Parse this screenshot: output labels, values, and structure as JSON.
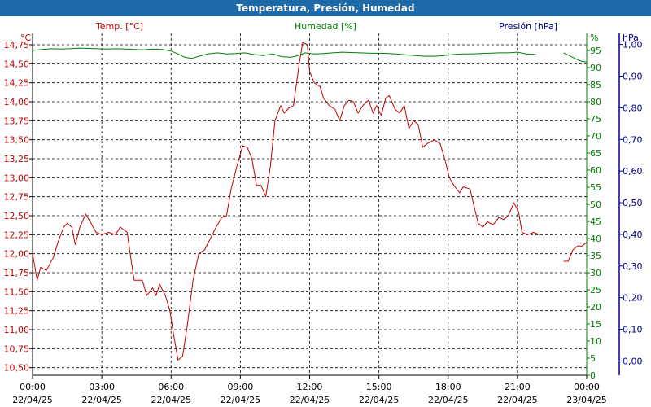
{
  "window": {
    "title": "Temperatura, Presión, Humedad"
  },
  "colors": {
    "temperature": "#c00000",
    "humidity": "#008000",
    "pressure": "#00008b",
    "titlebar": "#1e6aa8"
  },
  "chart_data": {
    "type": "line",
    "title": "Temperatura, Presión, Humedad",
    "legend": {
      "temperature": "Temp. [°C]",
      "humidity": "Humedad [%]",
      "pressure": "Presión [hPa]"
    },
    "axes": {
      "temperature": {
        "unit": "°C",
        "min": 10.4,
        "max": 14.9,
        "ticks": [
          "10,50",
          "10,75",
          "11,00",
          "11,25",
          "11,50",
          "11,75",
          "12,00",
          "12,25",
          "12,50",
          "12,75",
          "13,00",
          "13,25",
          "13,50",
          "13,75",
          "14,00",
          "14,25",
          "14,50",
          "14,75"
        ]
      },
      "humidity": {
        "unit": "%",
        "min": 0,
        "max": 100,
        "ticks": [
          "0",
          "5",
          "10",
          "15",
          "20",
          "25",
          "30",
          "35",
          "40",
          "45",
          "50",
          "55",
          "60",
          "65",
          "70",
          "75",
          "80",
          "85",
          "90",
          "95"
        ]
      },
      "pressure": {
        "unit": "hPa",
        "min": -0.045,
        "max": 1.035,
        "ticks": [
          "0,00",
          "0,10",
          "0,20",
          "0,30",
          "0,40",
          "0,50",
          "0,60",
          "0,70",
          "0,80",
          "0,90",
          "1,00"
        ]
      },
      "x": {
        "ticks": [
          {
            "time": "00:00",
            "date": "22/04/25"
          },
          {
            "time": "03:00",
            "date": "22/04/25"
          },
          {
            "time": "06:00",
            "date": "22/04/25"
          },
          {
            "time": "09:00",
            "date": "22/04/25"
          },
          {
            "time": "12:00",
            "date": "22/04/25"
          },
          {
            "time": "15:00",
            "date": "22/04/25"
          },
          {
            "time": "18:00",
            "date": "22/04/25"
          },
          {
            "time": "21:00",
            "date": "22/04/25"
          },
          {
            "time": "00:00",
            "date": "23/04/25"
          }
        ]
      }
    },
    "grid": true,
    "series": [
      {
        "name": "Temp. [°C]",
        "axis": "temperature",
        "segments": [
          [
            [
              0.0,
              12.0
            ],
            [
              0.2,
              11.65
            ],
            [
              0.35,
              11.82
            ],
            [
              0.6,
              11.78
            ],
            [
              0.9,
              11.95
            ],
            [
              1.1,
              12.15
            ],
            [
              1.35,
              12.35
            ],
            [
              1.5,
              12.4
            ],
            [
              1.7,
              12.35
            ],
            [
              1.85,
              12.12
            ],
            [
              2.05,
              12.35
            ],
            [
              2.3,
              12.52
            ],
            [
              2.5,
              12.42
            ],
            [
              2.75,
              12.28
            ],
            [
              3.0,
              12.25
            ],
            [
              3.3,
              12.28
            ],
            [
              3.6,
              12.25
            ],
            [
              3.8,
              12.35
            ],
            [
              4.1,
              12.28
            ],
            [
              4.25,
              11.95
            ],
            [
              4.4,
              11.65
            ],
            [
              4.75,
              11.65
            ],
            [
              4.95,
              11.45
            ],
            [
              5.2,
              11.55
            ],
            [
              5.35,
              11.45
            ],
            [
              5.5,
              11.6
            ],
            [
              5.75,
              11.45
            ],
            [
              5.95,
              11.25
            ],
            [
              6.1,
              10.95
            ],
            [
              6.3,
              10.6
            ],
            [
              6.5,
              10.65
            ],
            [
              6.7,
              11.05
            ],
            [
              6.95,
              11.65
            ],
            [
              7.2,
              12.0
            ],
            [
              7.45,
              12.05
            ],
            [
              7.7,
              12.2
            ],
            [
              7.95,
              12.35
            ],
            [
              8.2,
              12.48
            ],
            [
              8.4,
              12.5
            ],
            [
              8.6,
              12.85
            ],
            [
              8.85,
              13.15
            ],
            [
              9.1,
              13.42
            ],
            [
              9.3,
              13.4
            ],
            [
              9.5,
              13.25
            ],
            [
              9.7,
              12.9
            ],
            [
              9.9,
              12.9
            ],
            [
              10.1,
              12.75
            ],
            [
              10.3,
              13.15
            ],
            [
              10.5,
              13.75
            ],
            [
              10.75,
              13.95
            ],
            [
              10.9,
              13.85
            ],
            [
              11.1,
              13.92
            ],
            [
              11.3,
              13.95
            ],
            [
              11.55,
              14.5
            ],
            [
              11.7,
              14.78
            ],
            [
              11.9,
              14.75
            ],
            [
              12.0,
              14.4
            ],
            [
              12.2,
              14.25
            ],
            [
              12.45,
              14.2
            ],
            [
              12.6,
              14.05
            ],
            [
              12.85,
              13.95
            ],
            [
              13.1,
              13.9
            ],
            [
              13.3,
              13.75
            ],
            [
              13.5,
              13.95
            ],
            [
              13.7,
              14.02
            ],
            [
              13.9,
              14.0
            ],
            [
              14.1,
              13.85
            ],
            [
              14.3,
              13.95
            ],
            [
              14.55,
              14.02
            ],
            [
              14.75,
              13.85
            ],
            [
              14.9,
              13.95
            ],
            [
              15.1,
              13.82
            ],
            [
              15.3,
              14.05
            ],
            [
              15.45,
              14.08
            ],
            [
              15.7,
              13.9
            ],
            [
              15.9,
              13.85
            ],
            [
              16.1,
              13.95
            ],
            [
              16.3,
              13.65
            ],
            [
              16.5,
              13.75
            ],
            [
              16.7,
              13.7
            ],
            [
              16.9,
              13.4
            ],
            [
              17.1,
              13.45
            ],
            [
              17.4,
              13.5
            ],
            [
              17.65,
              13.45
            ],
            [
              17.85,
              13.25
            ],
            [
              18.05,
              13.0
            ],
            [
              18.25,
              12.9
            ],
            [
              18.5,
              12.8
            ],
            [
              18.65,
              12.88
            ],
            [
              18.95,
              12.85
            ],
            [
              19.1,
              12.65
            ],
            [
              19.3,
              12.4
            ],
            [
              19.5,
              12.35
            ],
            [
              19.7,
              12.42
            ],
            [
              19.95,
              12.38
            ],
            [
              20.2,
              12.48
            ],
            [
              20.4,
              12.45
            ],
            [
              20.6,
              12.5
            ],
            [
              20.85,
              12.67
            ],
            [
              21.05,
              12.55
            ],
            [
              21.2,
              12.28
            ],
            [
              21.45,
              12.25
            ],
            [
              21.7,
              12.28
            ],
            [
              21.95,
              12.25
            ]
          ],
          [
            [
              23.0,
              11.9
            ],
            [
              23.2,
              11.9
            ],
            [
              23.4,
              12.05
            ],
            [
              23.6,
              12.1
            ],
            [
              23.8,
              12.1
            ],
            [
              24.0,
              12.15
            ]
          ]
        ]
      },
      {
        "name": "Humedad [%]",
        "axis": "humidity",
        "segments": [
          [
            [
              0.0,
              95.0
            ],
            [
              0.4,
              95.3
            ],
            [
              0.8,
              95.5
            ],
            [
              1.2,
              95.4
            ],
            [
              1.6,
              95.5
            ],
            [
              2.0,
              95.7
            ],
            [
              2.4,
              95.6
            ],
            [
              2.8,
              95.5
            ],
            [
              3.2,
              95.4
            ],
            [
              3.6,
              95.5
            ],
            [
              4.0,
              95.4
            ],
            [
              4.4,
              95.3
            ],
            [
              4.8,
              95.2
            ],
            [
              5.2,
              95.4
            ],
            [
              5.6,
              95.3
            ],
            [
              6.0,
              94.8
            ],
            [
              6.3,
              94.0
            ],
            [
              6.6,
              93.0
            ],
            [
              6.9,
              92.7
            ],
            [
              7.2,
              93.3
            ],
            [
              7.6,
              94.0
            ],
            [
              8.0,
              94.3
            ],
            [
              8.4,
              94.0
            ],
            [
              8.8,
              94.1
            ],
            [
              9.2,
              94.3
            ],
            [
              9.6,
              93.8
            ],
            [
              10.0,
              93.5
            ],
            [
              10.4,
              94.0
            ],
            [
              10.8,
              93.2
            ],
            [
              11.2,
              93.0
            ],
            [
              11.5,
              93.5
            ],
            [
              11.8,
              94.3
            ],
            [
              12.2,
              94.0
            ],
            [
              12.6,
              94.1
            ],
            [
              13.0,
              94.3
            ],
            [
              13.4,
              94.5
            ],
            [
              13.8,
              94.4
            ],
            [
              14.2,
              94.3
            ],
            [
              14.6,
              94.2
            ],
            [
              15.0,
              94.2
            ],
            [
              15.4,
              94.1
            ],
            [
              15.8,
              94.0
            ],
            [
              16.2,
              93.7
            ],
            [
              16.6,
              93.5
            ],
            [
              17.0,
              93.3
            ],
            [
              17.4,
              93.3
            ],
            [
              17.8,
              93.5
            ],
            [
              18.2,
              93.8
            ],
            [
              18.6,
              94.0
            ],
            [
              19.0,
              94.0
            ],
            [
              19.4,
              94.1
            ],
            [
              19.8,
              94.2
            ],
            [
              20.2,
              94.3
            ],
            [
              20.6,
              94.3
            ],
            [
              21.0,
              94.5
            ],
            [
              21.4,
              94.0
            ],
            [
              21.8,
              93.8
            ]
          ],
          [
            [
              23.0,
              94.3
            ],
            [
              23.3,
              93.3
            ],
            [
              23.6,
              92.3
            ],
            [
              23.8,
              91.8
            ],
            [
              24.0,
              91.6
            ]
          ]
        ]
      }
    ]
  }
}
